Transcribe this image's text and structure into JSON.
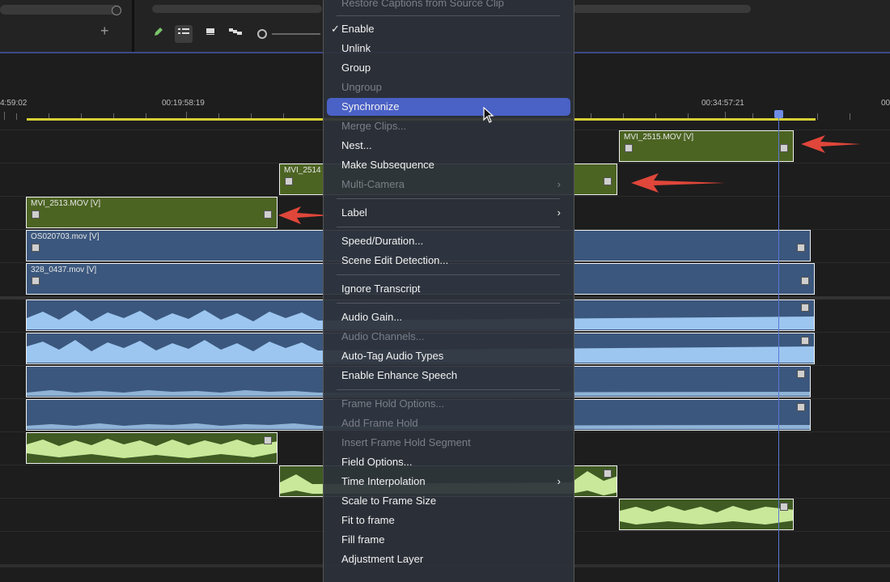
{
  "timecodes": [
    "4:59:02",
    "00:19:58:19",
    "00:34:57:21",
    "00"
  ],
  "toolbar": {
    "icons": [
      "pencil-icon",
      "list-view-icon",
      "clip-view-icon",
      "stack-view-icon",
      "zoom-slider"
    ],
    "add_glyph": "+"
  },
  "clips": {
    "v3": "MVI_2515.MOV [V]",
    "v2": "MVI_2514",
    "v1": "MVI_2513.MOV [V]",
    "b1": "OS020703.mov [V]",
    "b2": "328_0437.mov [V]"
  },
  "menu": {
    "top_item": "Restore Captions from Source Clip",
    "items": [
      {
        "label": "Enable",
        "checked": true,
        "disabled": false
      },
      {
        "label": "Unlink",
        "disabled": false
      },
      {
        "label": "Group",
        "disabled": false
      },
      {
        "label": "Ungroup",
        "disabled": true
      },
      {
        "label": "Synchronize",
        "disabled": false,
        "highlighted": true
      },
      {
        "label": "Merge Clips...",
        "disabled": true
      },
      {
        "label": "Nest...",
        "disabled": false
      },
      {
        "label": "Make Subsequence",
        "disabled": false
      },
      {
        "label": "Multi-Camera",
        "disabled": true,
        "submenu": true
      },
      {
        "label": "Label",
        "disabled": false,
        "submenu": true
      },
      {
        "label": "Speed/Duration...",
        "disabled": false
      },
      {
        "label": "Scene Edit Detection...",
        "disabled": false
      },
      {
        "label": "Ignore Transcript",
        "disabled": false
      },
      {
        "label": "Audio Gain...",
        "disabled": false
      },
      {
        "label": "Audio Channels...",
        "disabled": true
      },
      {
        "label": "Auto-Tag Audio Types",
        "disabled": false
      },
      {
        "label": "Enable Enhance Speech",
        "disabled": false
      },
      {
        "label": "Frame Hold Options...",
        "disabled": true
      },
      {
        "label": "Add Frame Hold",
        "disabled": true
      },
      {
        "label": "Insert Frame Hold Segment",
        "disabled": true
      },
      {
        "label": "Field Options...",
        "disabled": false
      },
      {
        "label": "Time Interpolation",
        "disabled": false,
        "submenu": true
      },
      {
        "label": "Scale to Frame Size",
        "disabled": false
      },
      {
        "label": "Fit to frame",
        "disabled": false
      },
      {
        "label": "Fill frame",
        "disabled": false
      },
      {
        "label": "Adjustment Layer",
        "disabled": false
      }
    ],
    "check_glyph": "✓",
    "submenu_glyph": "›"
  },
  "colors": {
    "menu_highlight": "#4a61c6",
    "video_clip_green": "#4c6422",
    "video_clip_blue": "#3b577d",
    "playhead": "#5b78d8",
    "ruler_work_area": "#d6cf35",
    "annotation_arrow": "#e0463a"
  }
}
